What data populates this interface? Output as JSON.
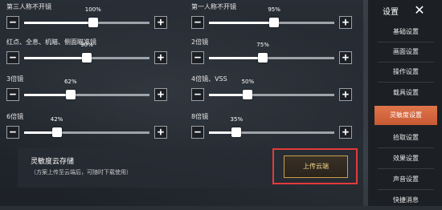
{
  "sliders": [
    {
      "label": "第三人称不开镜",
      "value_text": "100%",
      "fraction": 0.55
    },
    {
      "label": "第一人称不开镜",
      "value_text": "95%",
      "fraction": 0.52
    },
    {
      "label": "红点、全息、机瞄、侧面瞄准镜",
      "value_text": "90%",
      "fraction": 0.5
    },
    {
      "label": "2倍镜",
      "value_text": "75%",
      "fraction": 0.43
    },
    {
      "label": "3倍镜",
      "value_text": "62%",
      "fraction": 0.37
    },
    {
      "label": "4倍镜、VSS",
      "value_text": "50%",
      "fraction": 0.31
    },
    {
      "label": "6倍镜",
      "value_text": "42%",
      "fraction": 0.26
    },
    {
      "label": "8倍镜",
      "value_text": "35%",
      "fraction": 0.22
    }
  ],
  "cloud": {
    "title": "灵敏度云存储",
    "subtitle": "（方案上传至云端后，可随时下载使用）",
    "upload_label": "上传云端"
  },
  "sidebar": {
    "title": "设置",
    "items": [
      {
        "label": "基础设置",
        "active": false
      },
      {
        "label": "画面设置",
        "active": false
      },
      {
        "label": "操作设置",
        "active": false
      },
      {
        "label": "载具设置",
        "active": false
      },
      {
        "label": "灵敏度设置",
        "active": true
      },
      {
        "label": "拾取设置",
        "active": false
      },
      {
        "label": "效果设置",
        "active": false
      },
      {
        "label": "声音设置",
        "active": false
      },
      {
        "label": "快捷消息",
        "active": false
      }
    ]
  },
  "colors": {
    "accent": "#d9663e",
    "highlight": "#e23b3b",
    "upload_text": "#f1d48a"
  }
}
